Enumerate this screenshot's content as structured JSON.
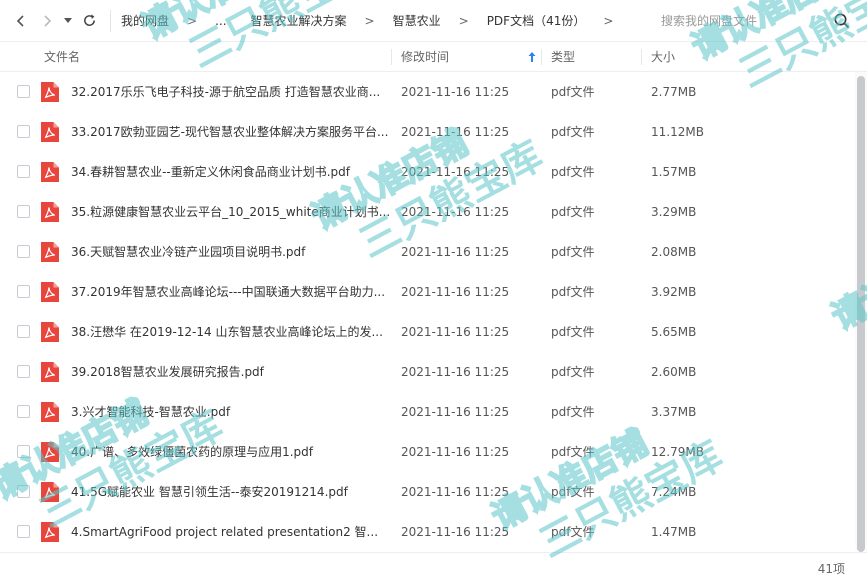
{
  "nav": {
    "back_icon": "chevron-left-icon",
    "forward_icon": "chevron-right-icon",
    "history_icon": "caret-down-icon",
    "refresh_icon": "refresh-icon"
  },
  "breadcrumb": [
    {
      "label": "我的网盘"
    },
    {
      "label": "..."
    },
    {
      "label": "智慧农业解决方案"
    },
    {
      "label": "智慧农业"
    },
    {
      "label": "PDF文档（41份）"
    }
  ],
  "search": {
    "placeholder": "搜索我的网盘文件"
  },
  "columns": {
    "name": "文件名",
    "modified": "修改时间",
    "type": "类型",
    "size": "大小"
  },
  "files": [
    {
      "name": "32.2017乐乐飞电子科技-源于航空品质 打造智慧农业商...",
      "modified": "2021-11-16 11:25",
      "type": "pdf文件",
      "size": "2.77MB"
    },
    {
      "name": "33.2017欧勃亚园艺-现代智慧农业整体解决方案服务平台...",
      "modified": "2021-11-16 11:25",
      "type": "pdf文件",
      "size": "11.12MB"
    },
    {
      "name": "34.春耕智慧农业--重新定义休闲食品商业计划书.pdf",
      "modified": "2021-11-16 11:25",
      "type": "pdf文件",
      "size": "1.57MB"
    },
    {
      "name": "35.粒源健康智慧农业云平台_10_2015_white商业计划书....",
      "modified": "2021-11-16 11:25",
      "type": "pdf文件",
      "size": "3.29MB"
    },
    {
      "name": "36.天赋智慧农业冷链产业园项目说明书.pdf",
      "modified": "2021-11-16 11:25",
      "type": "pdf文件",
      "size": "2.08MB"
    },
    {
      "name": "37.2019年智慧农业高峰论坛---中国联通大数据平台助力...",
      "modified": "2021-11-16 11:25",
      "type": "pdf文件",
      "size": "3.92MB"
    },
    {
      "name": "38.汪懋华 在2019-12-14  山东智慧农业高峰论坛上的发...",
      "modified": "2021-11-16 11:25",
      "type": "pdf文件",
      "size": "5.65MB"
    },
    {
      "name": "39.2018智慧农业发展研究报告.pdf",
      "modified": "2021-11-16 11:25",
      "type": "pdf文件",
      "size": "2.60MB"
    },
    {
      "name": "3.兴才智能科技-智慧农业.pdf",
      "modified": "2021-11-16 11:25",
      "type": "pdf文件",
      "size": "3.37MB"
    },
    {
      "name": "40.广谱、多效绿僵菌农药的原理与应用1.pdf",
      "modified": "2021-11-16 11:25",
      "type": "pdf文件",
      "size": "12.79MB"
    },
    {
      "name": "41.5G赋能农业  智慧引领生活--泰安20191214.pdf",
      "modified": "2021-11-16 11:25",
      "type": "pdf文件",
      "size": "7.24MB"
    },
    {
      "name": "4.SmartAgriFood project related presentation2 智...",
      "modified": "2021-11-16 11:25",
      "type": "pdf文件",
      "size": "1.47MB"
    }
  ],
  "status": {
    "count": "41项"
  },
  "watermark": {
    "line1": "请认准店铺",
    "line2": "三只熊宝库",
    "color": "#5cc6c9"
  },
  "colors": {
    "pdf_icon": "#e8453c",
    "sort_arrow": "#2f7ff0"
  }
}
